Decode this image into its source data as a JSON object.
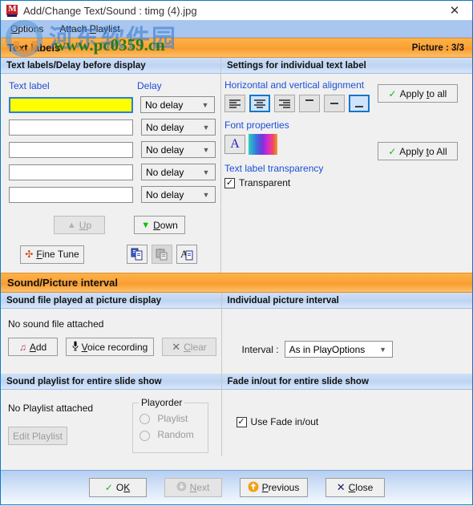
{
  "window": {
    "title": "Add/Change Text/Sound : timg (4).jpg",
    "app_icon": "vm-icon",
    "close_glyph": "✕"
  },
  "menubar": {
    "items": [
      {
        "label": "Options",
        "accel": "O"
      },
      {
        "label": "Attach Playlist",
        "accel": "P"
      }
    ]
  },
  "sections": {
    "text_labels": {
      "title": "Text labels",
      "picture_counter": "Picture : 3/3",
      "left_header": "Text labels/Delay before display",
      "right_header": "Settings for individual text label"
    },
    "sound_picture": {
      "title": "Sound/Picture interval",
      "sound_file_header": "Sound file played at picture display",
      "interval_header": "Individual picture interval",
      "playlist_header": "Sound playlist for entire slide show",
      "fade_header": "Fade in/out for entire slide show"
    }
  },
  "text_labels_panel": {
    "col_label": "Text label",
    "col_delay": "Delay",
    "rows": [
      {
        "value": "",
        "delay": "No delay",
        "active": true
      },
      {
        "value": "",
        "delay": "No delay",
        "active": false
      },
      {
        "value": "",
        "delay": "No delay",
        "active": false
      },
      {
        "value": "",
        "delay": "No delay",
        "active": false
      },
      {
        "value": "",
        "delay": "No delay",
        "active": false
      }
    ],
    "up_button": "Up",
    "down_button": "Down",
    "fine_tune_button": "Fine Tune",
    "icon_buttons": [
      {
        "name": "copy-icon",
        "enabled": true
      },
      {
        "name": "paste-icon",
        "enabled": false
      },
      {
        "name": "copy-font-icon",
        "enabled": true
      }
    ]
  },
  "settings_panel": {
    "alignment_label": "Horizontal and vertical alignment",
    "alignment_buttons": [
      {
        "name": "align-left-icon",
        "selected": false
      },
      {
        "name": "align-center-icon",
        "selected": true
      },
      {
        "name": "align-right-icon",
        "selected": false
      },
      {
        "name": "align-top-icon",
        "selected": false
      },
      {
        "name": "align-middle-icon",
        "selected": false
      },
      {
        "name": "align-bottom-icon",
        "selected": true
      }
    ],
    "font_label": "Font properties",
    "font_button_glyph": "A",
    "transparency_label": "Text label transparency",
    "transparent_checkbox": {
      "label": "Transparent",
      "checked": true
    },
    "apply_to_all_alignment": "Apply to all",
    "apply_to_all_font": "Apply to All"
  },
  "sound_panel": {
    "no_sound_text": "No sound file attached",
    "add_button": "Add",
    "voice_button": "Voice recording",
    "clear_button": "Clear",
    "clear_enabled": false
  },
  "interval_panel": {
    "label": "Interval :",
    "value": "As in PlayOptions"
  },
  "playlist_panel": {
    "no_playlist_text": "No Playlist attached",
    "edit_button": "Edit Playlist",
    "edit_enabled": false,
    "playorder_title": "Playorder",
    "options": [
      {
        "label": "Playlist",
        "selected": false
      },
      {
        "label": "Random",
        "selected": false
      }
    ]
  },
  "fade_panel": {
    "checkbox": {
      "label": "Use Fade in/out",
      "checked": true
    }
  },
  "footer": {
    "buttons": [
      {
        "label": "OK",
        "accel": "K",
        "enabled": true,
        "icon": "check-icon"
      },
      {
        "label": "Next",
        "accel": "N",
        "enabled": false,
        "icon": "down-arrow-circle-icon"
      },
      {
        "label": "Previous",
        "accel": "P",
        "enabled": true,
        "icon": "up-arrow-circle-icon"
      },
      {
        "label": "Close",
        "accel": "C",
        "enabled": true,
        "icon": "cross-icon"
      }
    ]
  },
  "watermark": {
    "cn_text": "河东软件园",
    "url_text": "www.pc0359.cn"
  },
  "colors": {
    "orange_band": "#fba338",
    "blue_header": "#bdd4f2",
    "accent_blue": "#1b4fd8",
    "active_field": "#ffff00",
    "green_check": "#19b319"
  }
}
